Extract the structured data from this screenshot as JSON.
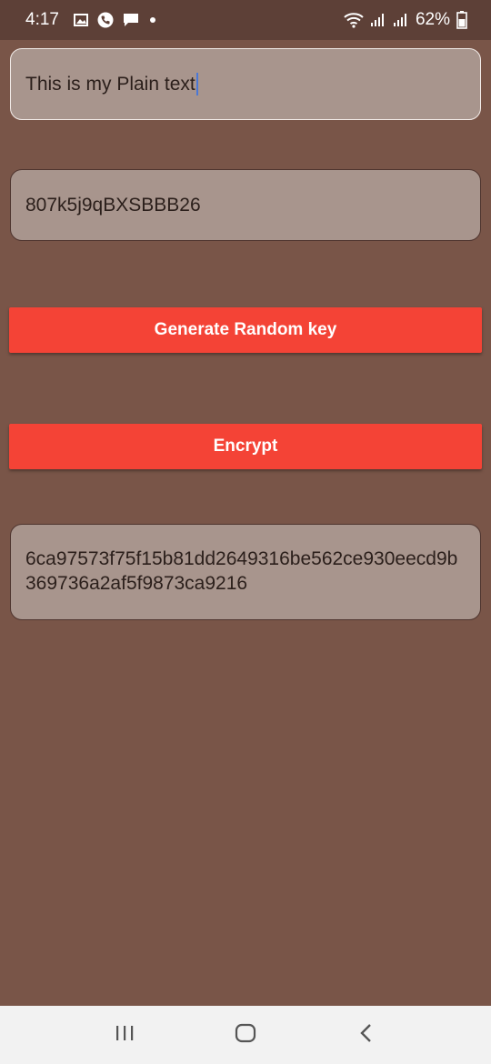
{
  "status_bar": {
    "time": "4:17",
    "battery": "62%",
    "icons": [
      "gallery-icon",
      "phone-icon",
      "message-icon",
      "dot-icon",
      "wifi-icon",
      "signal-icon",
      "signal-icon-2",
      "battery-icon"
    ]
  },
  "inputs": {
    "plain_text": {
      "value": "This is my Plain text"
    },
    "key": {
      "value": "807k5j9qBXSBBB26"
    }
  },
  "buttons": {
    "generate_label": "Generate Random key",
    "encrypt_label": "Encrypt"
  },
  "output": {
    "cipher_text": "6ca97573f75f15b81dd2649316be562ce930eecd9b369736a2af5f9873ca9216"
  },
  "colors": {
    "app_background": "#795548",
    "status_bar": "#5d4037",
    "field_background": "#a8958d",
    "button": "#f44336",
    "cursor": "#4a78d6"
  },
  "nav_bar": {
    "icons": [
      "recents-icon",
      "home-icon",
      "back-icon"
    ]
  }
}
